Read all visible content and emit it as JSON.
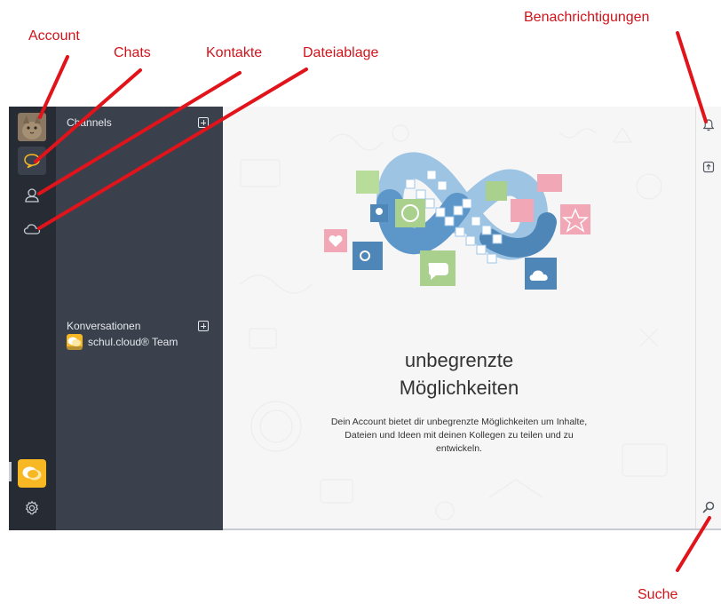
{
  "callouts": {
    "account": "Account",
    "chats": "Chats",
    "kontakte": "Kontakte",
    "dateiablage": "Dateiablage",
    "benachrichtigungen": "Benachrichtigungen",
    "suche": "Suche"
  },
  "panel": {
    "channels_title": "Channels",
    "conversations_title": "Konversationen",
    "conversations": [
      {
        "label": "schul.cloud® Team"
      }
    ]
  },
  "main": {
    "title_line1": "unbegrenzte",
    "title_line2": "Möglichkeiten",
    "description": "Dein Account bietet dir unbegrenzte Möglichkeiten um Inhalte, Dateien und Ideen mit deinen Kollegen zu teilen und zu entwickeln."
  },
  "colors": {
    "annotation": "#d0141b",
    "rail": "#272b33",
    "panel": "#3a414d",
    "brand_yellow": "#f7b823",
    "infinity_blue": "#5d97c9"
  },
  "icons": {
    "rail": [
      "avatar",
      "chat-bubble-icon",
      "contact-icon",
      "cloud-icon",
      "app-logo-icon",
      "settings-gear-icon"
    ],
    "right": [
      "bell-icon",
      "upload-icon",
      "search-icon"
    ]
  }
}
